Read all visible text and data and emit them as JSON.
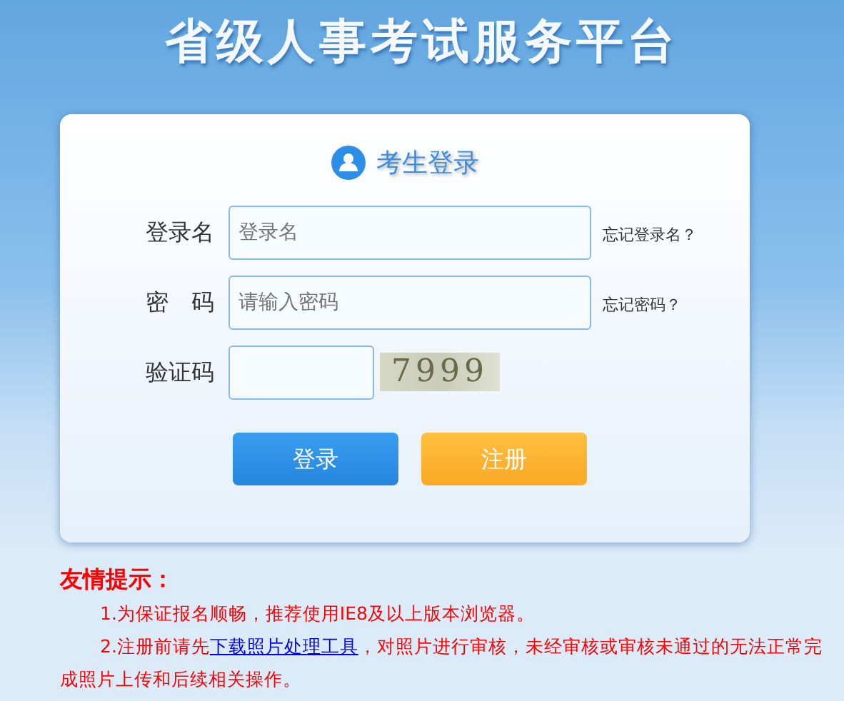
{
  "header": {
    "title": "省级人事考试服务平台"
  },
  "login": {
    "title": "考生登录",
    "fields": [
      {
        "label": "登录名",
        "placeholder": "登录名",
        "help": "忘记登录名？",
        "kind": "text"
      },
      {
        "label": "密　码",
        "placeholder": "请输入密码",
        "help": "忘记密码？",
        "kind": "password"
      },
      {
        "label": "验证码",
        "kind": "captcha",
        "captcha": "7999"
      }
    ],
    "buttons": [
      {
        "label": "登录",
        "kind": "primary"
      },
      {
        "label": "注册",
        "kind": "secondary"
      }
    ]
  },
  "tips": {
    "title": "友情提示：",
    "items": [
      {
        "before": "1.为保证报名顺畅，推荐使用IE8及以上版本浏览器。"
      },
      {
        "before": "2.注册前请先",
        "link": "下载照片处理工具",
        "after": "，对照片进行审核，未经审核或审核未通过的无法正常完成照片上传和后续相关操作。"
      }
    ]
  }
}
